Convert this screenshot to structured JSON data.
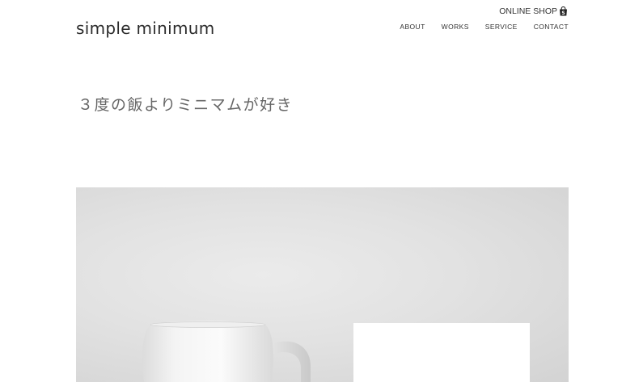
{
  "header": {
    "logo_text": "simple minimum",
    "online_shop_label": "ONLINE SHOP",
    "online_shop_icon": "shopping-bag-icon",
    "nav": [
      {
        "label": "ABOUT"
      },
      {
        "label": "WORKS"
      },
      {
        "label": "SERVICE"
      },
      {
        "label": "CONTACT"
      }
    ]
  },
  "main": {
    "tagline": "３度の飯よりミニマムが好き",
    "hero_subject": "white mug"
  },
  "colors": {
    "background": "#ffffff",
    "text": "#333333",
    "tagline": "#666666",
    "hero_background": "#e2e2e2"
  }
}
